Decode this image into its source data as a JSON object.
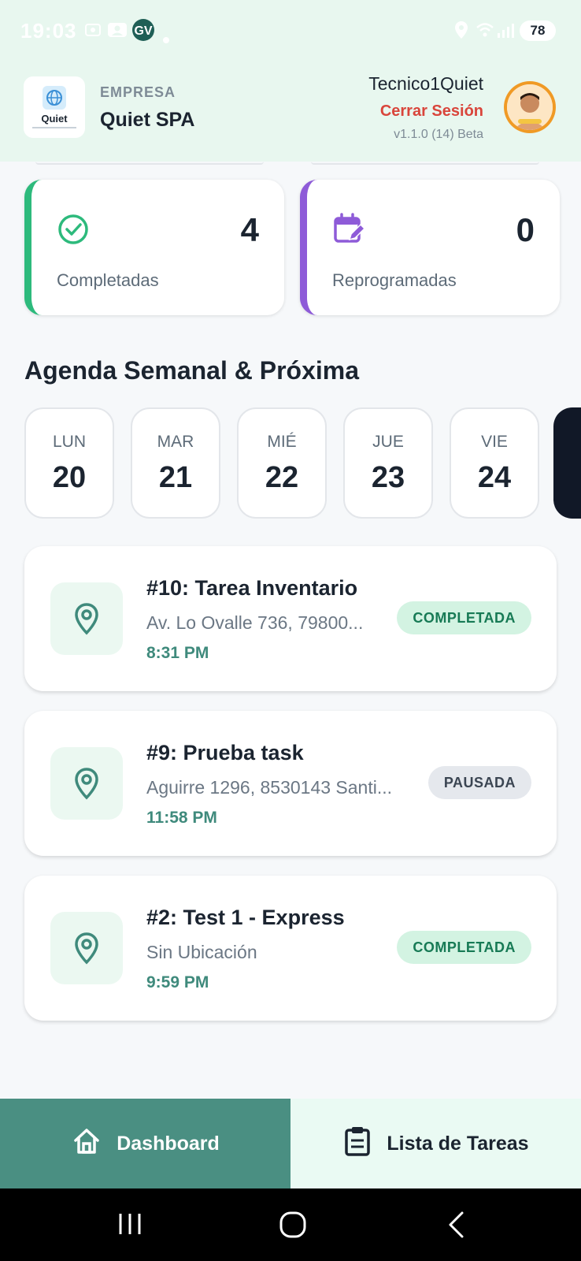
{
  "status_bar": {
    "time": "19:03",
    "battery": "78"
  },
  "header": {
    "logo_text": "Quiet",
    "company_label": "EMPRESA",
    "company_name": "Quiet SPA",
    "user_name": "Tecnico1Quiet",
    "logout_label": "Cerrar Sesión",
    "version": "v1.1.0 (14) Beta"
  },
  "stats": [
    {
      "label": "Completadas",
      "value": "4",
      "icon": "check-circle-icon",
      "accent": "#2dba7c"
    },
    {
      "label": "Reprogramadas",
      "value": "0",
      "icon": "calendar-edit-icon",
      "accent": "#8e5bd8"
    }
  ],
  "agenda": {
    "title": "Agenda Semanal & Próxima",
    "days": [
      {
        "name": "LUN",
        "num": "20"
      },
      {
        "name": "MAR",
        "num": "21"
      },
      {
        "name": "MIÉ",
        "num": "22"
      },
      {
        "name": "JUE",
        "num": "23"
      },
      {
        "name": "VIE",
        "num": "24"
      }
    ]
  },
  "tasks": [
    {
      "title": "#10: Tarea Inventario",
      "address": "Av. Lo Ovalle 736, 79800...",
      "time": "8:31 PM",
      "status": "COMPLETADA"
    },
    {
      "title": "#9: Prueba task",
      "address": "Aguirre 1296, 8530143 Santi...",
      "time": "11:58 PM",
      "status": "PAUSADA"
    },
    {
      "title": "#2: Test 1 - Express",
      "address": "Sin Ubicación",
      "time": "9:59 PM",
      "status": "COMPLETADA"
    }
  ],
  "bottom_nav": {
    "dashboard_label": "Dashboard",
    "tasks_label": "Lista de Tareas"
  },
  "colors": {
    "header_bg": "#e8f7ef",
    "primary": "#4a8f82",
    "danger": "#d9453b",
    "success": "#2dba7c",
    "purple": "#8e5bd8"
  }
}
